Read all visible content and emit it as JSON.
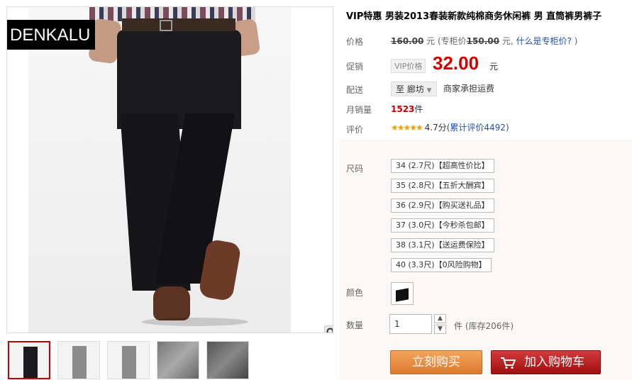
{
  "brand": {
    "logo_text": "DENKALU"
  },
  "product": {
    "title": "VIP特惠 男装2013春装新款纯棉商务休闲裤 男 直筒裤男裤子",
    "price_label": "价格",
    "original_price": "160.00",
    "yuan": "元",
    "counter_prefix": "(专柜价",
    "counter_price": "150.00",
    "counter_suffix": "元,",
    "counter_link": "什么是专柜价?",
    "counter_close": ")",
    "promo_label": "促销",
    "vip_tag": "VIP价格",
    "promo_price": "32.00",
    "promo_unit": "元",
    "ship_label": "配送",
    "ship_to": "至 廊坊",
    "ship_note": "商家承担运费",
    "sales_label": "月销量",
    "sales_count": "1523",
    "sales_unit": "件",
    "rating_label": "评价",
    "rating_score": "4.7分",
    "rating_count_text": "(累计评价4492)"
  },
  "sku": {
    "size_label": "尺码",
    "sizes": [
      "34 (2.7尺)【超高性价比】",
      "35 (2.8尺)【五折大酬宾】",
      "36 (2.9尺)【购买送礼品】",
      "37 (3.0尺)【今秒杀包邮】",
      "38 (3.1尺)【送运费保险】",
      "40 (3.3尺)【0风险购物】"
    ],
    "color_label": "颜色",
    "qty_label": "数量",
    "qty_value": "1",
    "qty_unit": "件",
    "stock_text": "(库存206件)"
  },
  "actions": {
    "buy_now": "立刻购买",
    "add_cart": "加入购物车"
  },
  "colors": {
    "price_red": "#d40000",
    "buy_orange": "#dd7a2c",
    "cart_red": "#a10f0f",
    "link_blue": "#1f4fb0"
  },
  "icons": {
    "zoom": "magnifier-icon",
    "cart": "shopping-cart-icon"
  }
}
